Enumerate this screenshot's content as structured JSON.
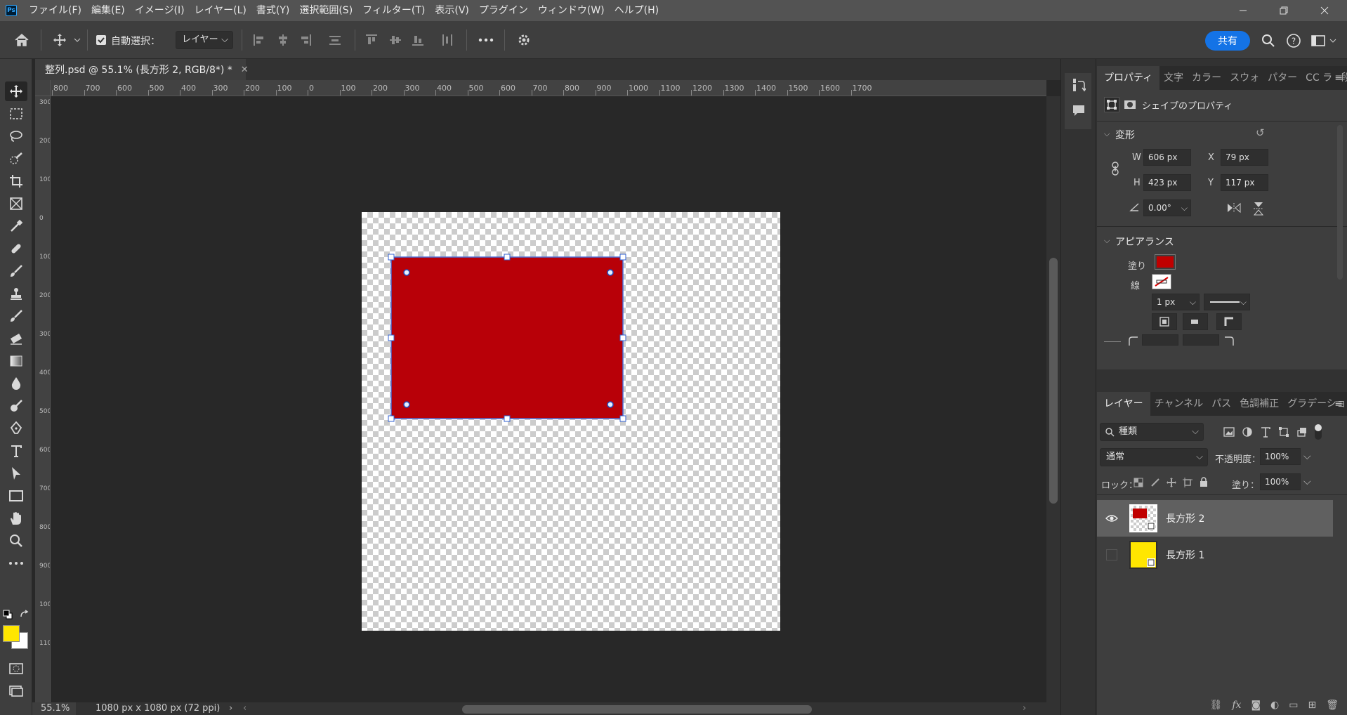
{
  "app": {
    "logo_text": "Ps",
    "menus": [
      "ファイル(F)",
      "編集(E)",
      "イメージ(I)",
      "レイヤー(L)",
      "書式(Y)",
      "選択範囲(S)",
      "フィルター(T)",
      "表示(V)",
      "プラグイン",
      "ウィンドウ(W)",
      "ヘルプ(H)"
    ]
  },
  "options": {
    "auto_select_label": "自動選択：",
    "auto_select_checked": true,
    "auto_select_target": "レイヤー",
    "share_label": "共有"
  },
  "document": {
    "tab_title": "整列.psd @ 55.1% (長方形 2, RGB/8*) *",
    "zoom": "55.1%",
    "info": "1080 px x 1080 px (72 ppi)"
  },
  "rulers": {
    "h_ticks": [
      "800",
      "700",
      "600",
      "500",
      "400",
      "300",
      "200",
      "100",
      "0",
      "100",
      "200",
      "300",
      "400",
      "500",
      "600",
      "700",
      "800",
      "900",
      "1000",
      "1100",
      "1200",
      "1300",
      "1400",
      "1500",
      "1600",
      "1700"
    ],
    "v_ticks": [
      "300",
      "200",
      "100",
      "0",
      "100",
      "200",
      "300",
      "400",
      "500",
      "600",
      "700",
      "800",
      "900",
      "1000",
      "1100"
    ]
  },
  "properties": {
    "tabs": [
      "プロパティ",
      "文字",
      "カラー",
      "スウォ",
      "パター",
      "CC ラ",
      "段落"
    ],
    "header": "シェイプのプロパティ",
    "transform_title": "変形",
    "w_label": "W",
    "w_value": "606 px",
    "h_label": "H",
    "h_value": "423 px",
    "x_label": "X",
    "x_value": "79 px",
    "y_label": "Y",
    "y_value": "117 px",
    "angle_value": "0.00°",
    "appearance_title": "アピアランス",
    "fill_label": "塗り",
    "stroke_label": "線",
    "stroke_width": "1 px",
    "fill_color": "#c00000"
  },
  "layers_panel": {
    "tabs": [
      "レイヤー",
      "チャンネル",
      "パス",
      "色調補正",
      "グラデーション"
    ],
    "filter_kind": "種類",
    "blend_mode": "通常",
    "opacity_label": "不透明度：",
    "opacity_value": "100%",
    "lock_label": "ロック：",
    "fill_label": "塗り：",
    "fill_value": "100%",
    "layers": [
      {
        "name": "長方形 2",
        "visible": true,
        "selected": true,
        "color": "#c00000"
      },
      {
        "name": "長方形 1",
        "visible": false,
        "selected": false,
        "color": "#ffe600"
      }
    ]
  },
  "colors": {
    "foreground": "#ffe600",
    "background": "#ffffff",
    "rectangle": "#b80008",
    "accent": "#1473e6"
  }
}
